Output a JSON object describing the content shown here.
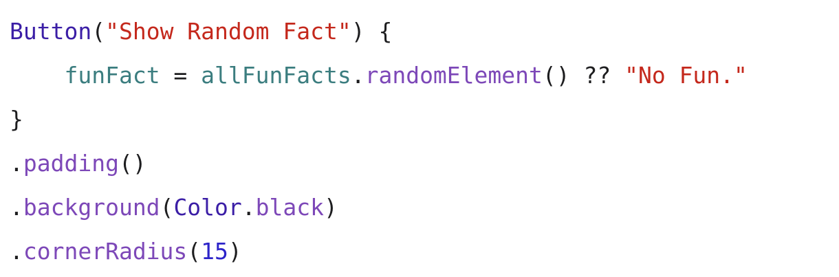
{
  "code": {
    "lines": [
      [
        {
          "text": "Button",
          "kind": "keyword-type"
        },
        {
          "text": "(",
          "kind": "plain"
        },
        {
          "text": "\"Show Random Fact\"",
          "kind": "string"
        },
        {
          "text": ") {",
          "kind": "plain"
        }
      ],
      [
        {
          "text": "    ",
          "kind": "plain"
        },
        {
          "text": "funFact",
          "kind": "var"
        },
        {
          "text": " = ",
          "kind": "plain"
        },
        {
          "text": "allFunFacts",
          "kind": "var"
        },
        {
          "text": ".",
          "kind": "plain"
        },
        {
          "text": "randomElement",
          "kind": "method"
        },
        {
          "text": "() ?? ",
          "kind": "plain"
        },
        {
          "text": "\"No Fun.\"",
          "kind": "string"
        }
      ],
      [
        {
          "text": "}",
          "kind": "plain"
        }
      ],
      [
        {
          "text": ".",
          "kind": "plain"
        },
        {
          "text": "padding",
          "kind": "method"
        },
        {
          "text": "()",
          "kind": "plain"
        }
      ],
      [
        {
          "text": ".",
          "kind": "plain"
        },
        {
          "text": "background",
          "kind": "method"
        },
        {
          "text": "(",
          "kind": "plain"
        },
        {
          "text": "Color",
          "kind": "keyword-type"
        },
        {
          "text": ".",
          "kind": "plain"
        },
        {
          "text": "black",
          "kind": "method"
        },
        {
          "text": ")",
          "kind": "plain"
        }
      ],
      [
        {
          "text": ".",
          "kind": "plain"
        },
        {
          "text": "cornerRadius",
          "kind": "method"
        },
        {
          "text": "(",
          "kind": "plain"
        },
        {
          "text": "15",
          "kind": "number"
        },
        {
          "text": ")",
          "kind": "plain"
        }
      ]
    ]
  },
  "colors": {
    "keyword_type": "#3b1ea6",
    "string": "#c4281c",
    "variable": "#3b7d7f",
    "method": "#7d48b8",
    "plain": "#1d1d1f",
    "number": "#2d24c9",
    "background": "#ffffff"
  }
}
